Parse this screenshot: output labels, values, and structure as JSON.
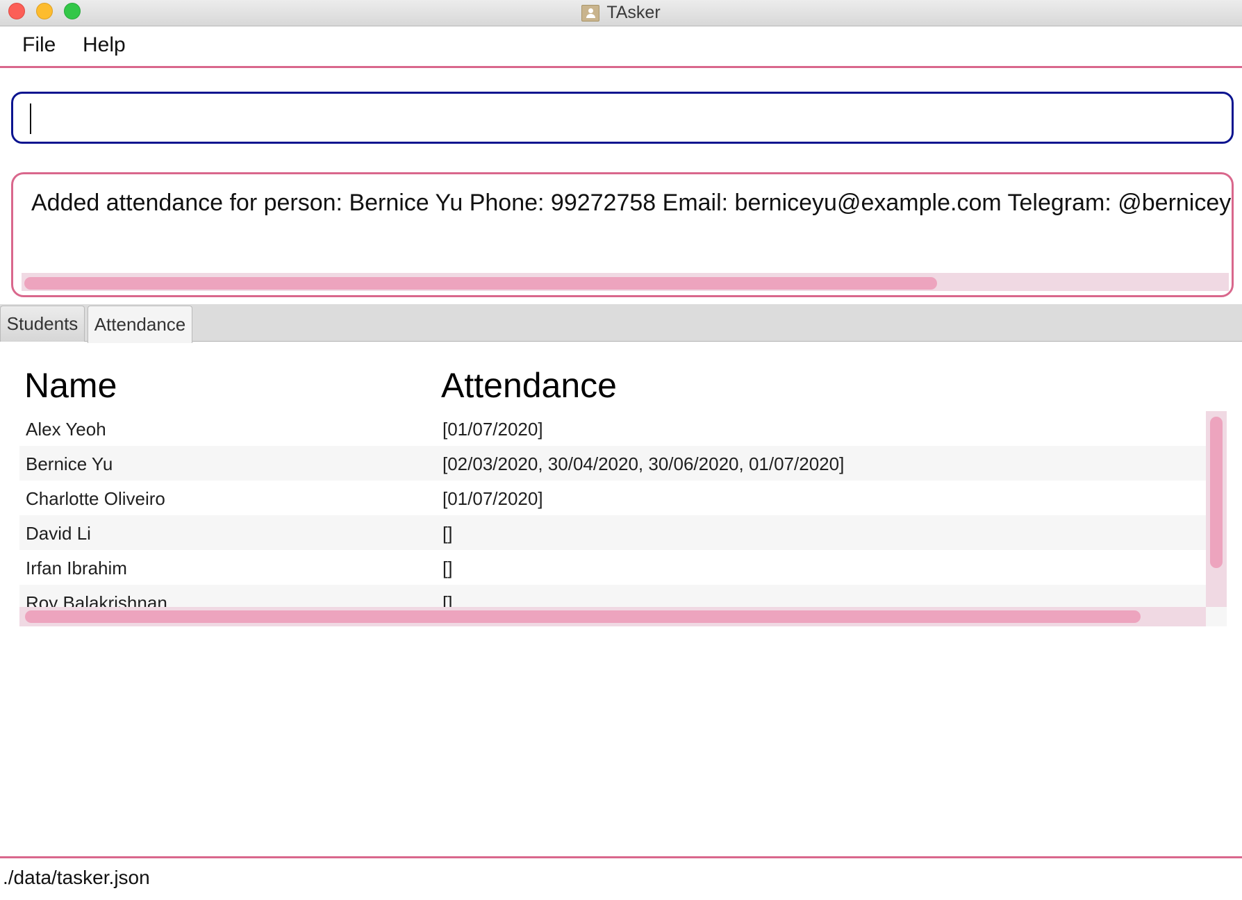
{
  "window": {
    "title": "TAsker",
    "icon": "address-book-icon"
  },
  "menu": {
    "items": [
      "File",
      "Help"
    ]
  },
  "command": {
    "value": "",
    "placeholder": ""
  },
  "result": {
    "text": "Added attendance for person: Bernice Yu Phone: 99272758 Email: berniceyu@example.com Telegram: @berniceyu Ma"
  },
  "tabs": [
    {
      "label": "Students",
      "active": false
    },
    {
      "label": "Attendance",
      "active": true
    }
  ],
  "table": {
    "headers": {
      "name": "Name",
      "attendance": "Attendance"
    },
    "rows": [
      {
        "name": "Alex Yeoh",
        "attendance": "[01/07/2020]"
      },
      {
        "name": "Bernice Yu",
        "attendance": "[02/03/2020, 30/04/2020, 30/06/2020, 01/07/2020]"
      },
      {
        "name": "Charlotte Oliveiro",
        "attendance": "[01/07/2020]"
      },
      {
        "name": "David Li",
        "attendance": "[]"
      },
      {
        "name": "Irfan Ibrahim",
        "attendance": "[]"
      },
      {
        "name": "Roy Balakrishnan",
        "attendance": "[]"
      }
    ]
  },
  "status": {
    "path": "./data/tasker.json"
  },
  "colors": {
    "accent_pink": "#d9678c",
    "command_border": "#0b148f",
    "scroll_thumb": "#eda4be",
    "scroll_track": "#f0d9e3"
  }
}
